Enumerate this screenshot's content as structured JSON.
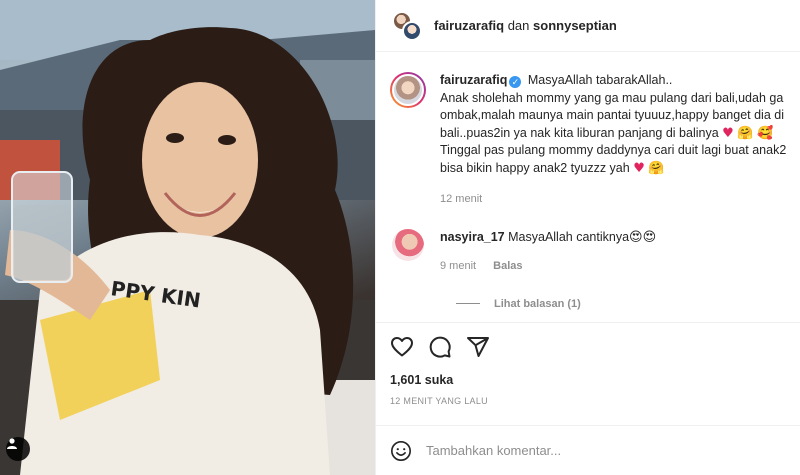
{
  "header": {
    "user1": "fairuzarafiq",
    "connector": "dan",
    "user2": "sonnyseptian"
  },
  "caption": {
    "username": "fairuzarafiq",
    "lines": [
      "MasyaAllah tabarakAllah..",
      "Anak sholehah mommy yang ga mau pulang dari bali,udah ga",
      "ombak,malah maunya main pantai tyuuuz,happy banget dia di",
      "bali..puas2in ya nak kita liburan panjang di balinya",
      "Tinggal pas pulang mommy daddynya cari duit lagi buat anak2",
      "bisa bikin happy anak2 tyuzzz yah"
    ],
    "time": "12 menit"
  },
  "comment": {
    "username": "nasyira_17",
    "text": "MasyaAllah cantiknya",
    "time": "9 menit",
    "reply_label": "Balas",
    "view_replies": "Lihat balasan (1)"
  },
  "actions": {
    "likes": "1,601 suka",
    "time_ago": "12 MENIT YANG LALU"
  },
  "add_comment": {
    "placeholder": "Tambahkan komentar..."
  }
}
